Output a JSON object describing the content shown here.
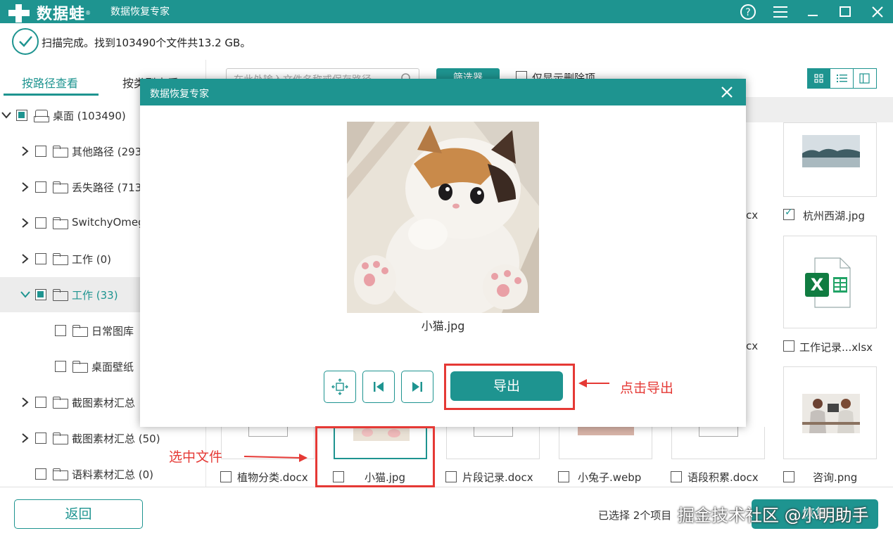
{
  "titlebar": {
    "brand": "数据蛙",
    "reg": "®",
    "app_name": "数据恢复专家"
  },
  "status": {
    "text": "扫描完成。找到103490个文件共13.2 GB。"
  },
  "left_tabs": {
    "by_path": "按路径查看",
    "by_type": "按类型查看"
  },
  "tree": [
    {
      "label": "桌面 (103490)",
      "expand": "v",
      "check": "partial",
      "icon": "drive-icon"
    },
    {
      "label": "其他路径 (293",
      "expand": ">",
      "check": "none",
      "icon": "folder-icon"
    },
    {
      "label": "丢失路径 (713",
      "expand": ">",
      "check": "none",
      "icon": "folder-icon"
    },
    {
      "label": "SwitchyOmeg",
      "expand": ">",
      "check": "none",
      "icon": "folder-icon"
    },
    {
      "label": "工作 (0)",
      "expand": ">",
      "check": "none",
      "icon": "folder-icon"
    },
    {
      "label": "工作 (33)",
      "expand": "v",
      "check": "partial",
      "icon": "folder-icon",
      "selected": true
    },
    {
      "label": "日常图库",
      "expand": "",
      "check": "none",
      "icon": "folder-icon"
    },
    {
      "label": "桌面壁纸",
      "expand": "",
      "check": "none",
      "icon": "folder-icon"
    },
    {
      "label": "截图素材汇总",
      "expand": ">",
      "check": "none",
      "icon": "folder-icon"
    },
    {
      "label": "截图素材汇总 (50)",
      "expand": ">",
      "check": "none",
      "icon": "folder-icon"
    },
    {
      "label": "语料素材汇总 (0)",
      "expand": "",
      "check": "none",
      "icon": "folder-icon"
    }
  ],
  "toolbar": {
    "search_placeholder": "在此处输入文件名称或保存路径",
    "filter": "筛选器",
    "only_deleted": "仅显示删除项"
  },
  "files_right_col": [
    {
      "name": "杭州西湖.jpg",
      "checked": true
    },
    {
      "name": "工作记录...xlsx",
      "checked": false
    }
  ],
  "partial_labels": {
    "row1": "cx",
    "row2": "cx"
  },
  "files_bottom_row": [
    {
      "name": "植物分类.docx",
      "checked": false
    },
    {
      "name": "小猫.jpg",
      "checked": false
    },
    {
      "name": "片段记录.docx",
      "checked": false
    },
    {
      "name": "小兔子.webp",
      "checked": false
    },
    {
      "name": "语段积累.docx",
      "checked": false
    },
    {
      "name": "咨询.png",
      "checked": false
    }
  ],
  "bottom": {
    "back": "返回",
    "selected_info": "已选择 2个项目",
    "recover": "恢复"
  },
  "watermark": "掘金技术社区 @小明助手",
  "dialog": {
    "title": "数据恢复专家",
    "filename": "小猫.jpg",
    "export": "导出"
  },
  "annotations": {
    "click_export": "点击导出",
    "select_file": "选中文件"
  },
  "colors": {
    "accent": "#1e9490",
    "annotation": "#e53935"
  }
}
